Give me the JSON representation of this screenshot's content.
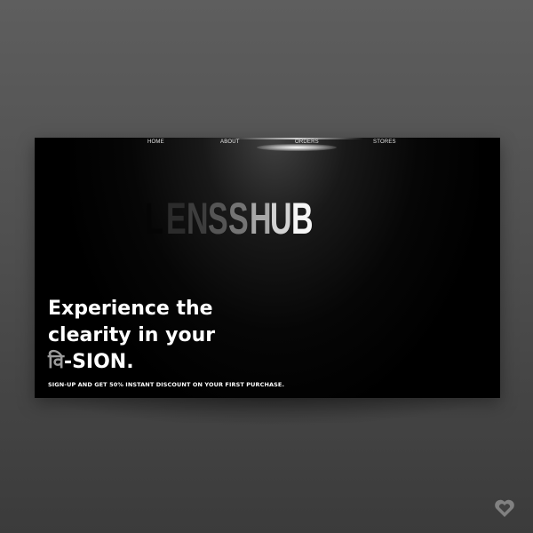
{
  "nav": {
    "items": [
      {
        "label": "HOME"
      },
      {
        "label": "ABOUT"
      },
      {
        "label": "ORDERS"
      },
      {
        "label": "STORES"
      }
    ]
  },
  "brand": {
    "letters": [
      "L",
      "E",
      "N",
      "S",
      "S",
      "H",
      "U",
      "B"
    ],
    "colors": [
      "#050505",
      "#2b2b2b",
      "#3d3d3d",
      "#555555",
      "#747474",
      "#a7a7a7",
      "#d2d2d2",
      "#f6f6f6"
    ]
  },
  "hero": {
    "line1": "Experience the",
    "line2": "clearity in your",
    "line3_accent": "वि",
    "line3_rest": "-SION."
  },
  "promo": {
    "text": "SIGN-UP AND GET 50% INSTANT DISCOUNT ON YOUR FIRST PURCHASE."
  },
  "corner": {
    "icon": "heart-icon"
  }
}
